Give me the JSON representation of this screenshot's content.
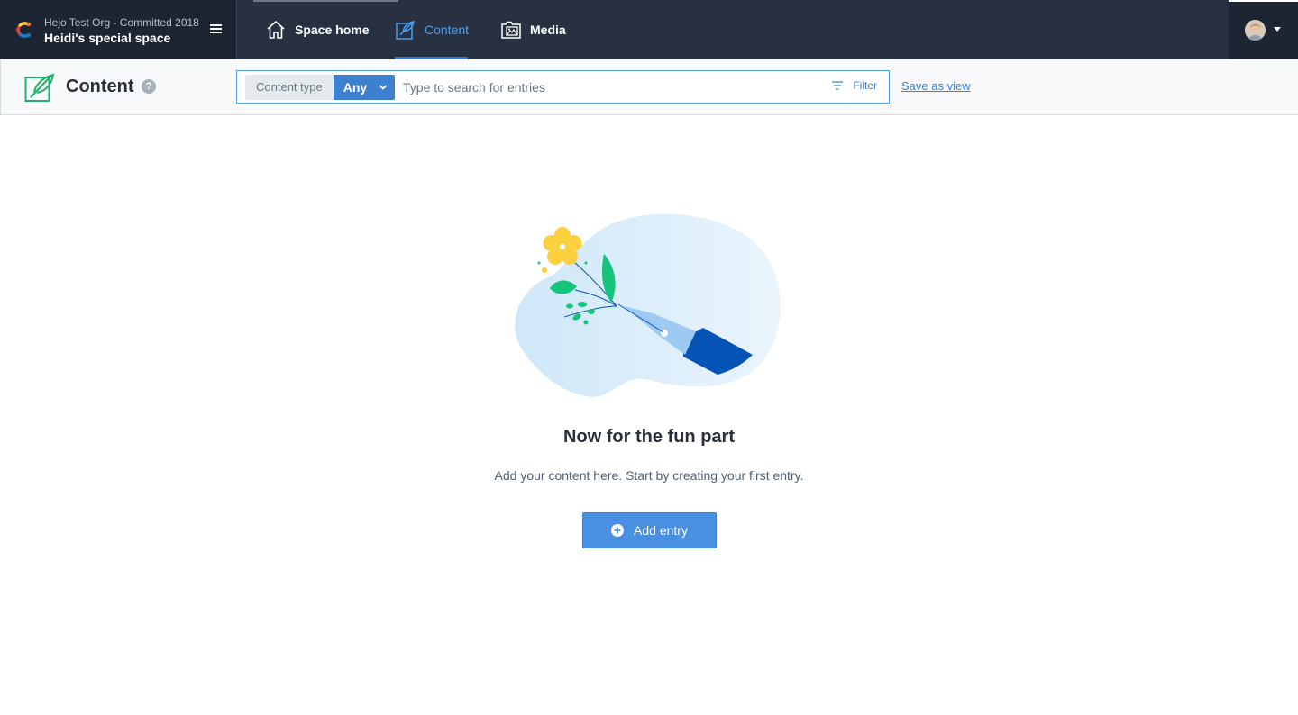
{
  "topbar": {
    "org_name": "Hejo Test Org - Committed 2018",
    "space_name": "Heidi's special space",
    "tabs": [
      {
        "label": "Space home",
        "icon": "home-icon",
        "active": false
      },
      {
        "label": "Content",
        "icon": "content-quill-icon",
        "active": true
      },
      {
        "label": "Media",
        "icon": "media-image-icon",
        "active": false
      }
    ]
  },
  "header": {
    "title": "Content",
    "help_glyph": "?",
    "content_type_label": "Content type",
    "content_type_value": "Any",
    "search_placeholder": "Type to search for entries",
    "filter_label": "Filter",
    "save_view_label": "Save as view"
  },
  "empty_state": {
    "title": "Now for the fun part",
    "description": "Add your content here. Start by creating your first entry.",
    "button_label": "Add entry"
  },
  "colors": {
    "nav_bg": "#273142",
    "nav_dark": "#1d2533",
    "accent_blue": "#4a90e2",
    "active_tab": "#4b9df0",
    "header_bg": "#f7f9fa"
  }
}
